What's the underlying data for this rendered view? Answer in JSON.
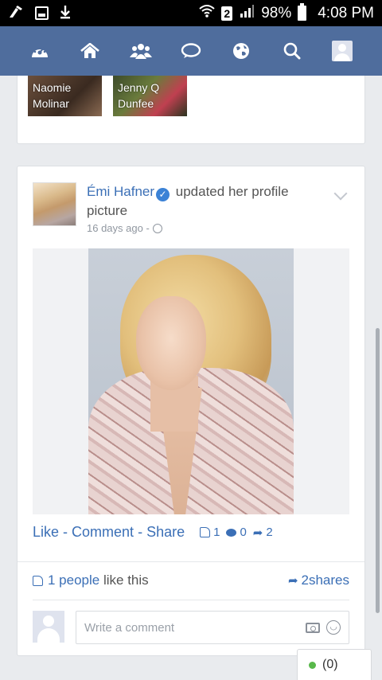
{
  "status_bar": {
    "battery_percent": "98%",
    "time": "4:08 PM",
    "sim_label": "2",
    "icons": [
      "cleaner-icon",
      "screenshot-icon",
      "download-icon",
      "wifi-icon",
      "signal-icon",
      "battery-icon"
    ]
  },
  "navbar": {
    "items": [
      "dashboard-icon",
      "home-icon",
      "friends-icon",
      "messages-icon",
      "globe-icon",
      "search-icon",
      "profile-icon"
    ]
  },
  "friends_preview": [
    {
      "name_line1": "Naomie",
      "name_line2": "Molinar"
    },
    {
      "name_line1": "Jenny Q",
      "name_line2": "Dunfee"
    }
  ],
  "post": {
    "author": "Émi Hafner",
    "action_text": "updated her profile picture",
    "time_ago": "16 days ago -",
    "actions": {
      "like": "Like",
      "comment": "Comment",
      "share": "Share",
      "separator": "-"
    },
    "counts": {
      "likes": "1",
      "comments": "0",
      "shares": "2"
    },
    "likes_summary": {
      "count_text": "1 people",
      "suffix": " like this"
    },
    "shares_text": "2shares",
    "comment_placeholder": "Write a comment"
  },
  "chat": {
    "count": "(0)"
  },
  "colors": {
    "nav_bg": "#4f6d9d",
    "link_blue": "#3b6fb6",
    "online_green": "#58b84a"
  }
}
